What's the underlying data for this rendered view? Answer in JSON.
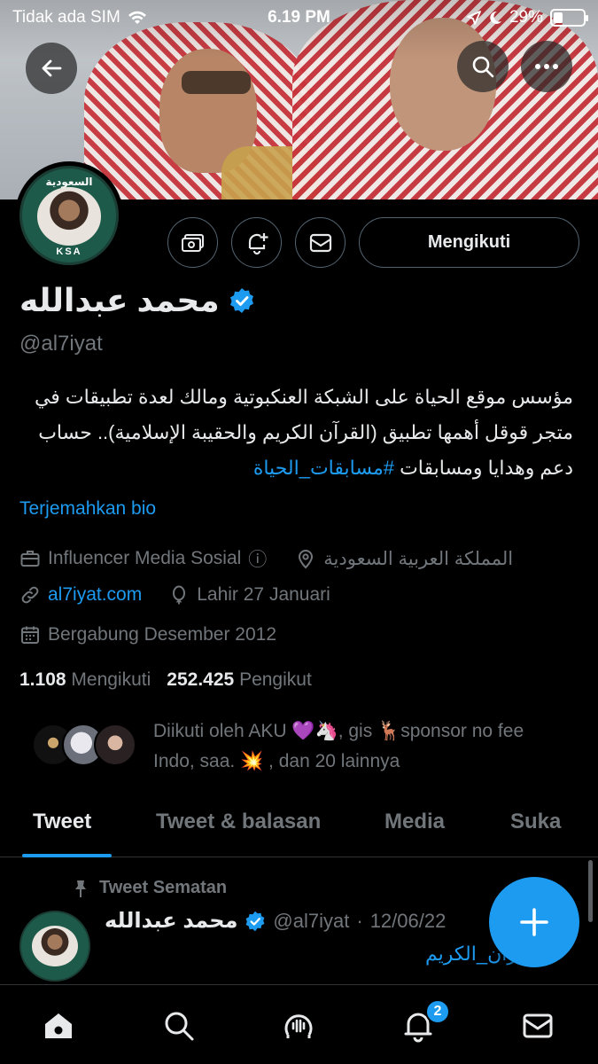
{
  "status_bar": {
    "carrier": "Tidak ada SIM",
    "time": "6.19 PM",
    "battery": "29%",
    "battery_level": 0.29
  },
  "profile": {
    "display_name": "محمد عبدالله",
    "handle": "@al7iyat",
    "banner_text": "السعودية",
    "banner_subtext": "KSA",
    "bio_main": "مؤسس موقع الحياة على الشبكة العنكبوتية ومالك لعدة تطبيقات في متجر قوقل أهمها تطبيق (القرآن الكريم والحقيبة الإسلامية).. حساب دعم وهدايا ومسابقات",
    "bio_hashtag": "#مسابقات_الحياة",
    "translate_label": "Terjemahkan bio",
    "category": "Influencer Media Sosial",
    "info_glyph": "ⓘ",
    "location": "المملكة العربية السعودية",
    "website": "al7iyat.com",
    "birthday": "Lahir 27 Januari",
    "joined": "Bergabung Desember 2012",
    "following_count": "1.108",
    "following_label": "Mengikuti",
    "followers_count": "252.425",
    "followers_label": "Pengikut",
    "followed_by": "Diikuti oleh AKU 💜🦄, gis 🦌sponsor no fee Indo, saa. 💥 , dan 20 lainnya"
  },
  "actions": {
    "follow_label": "Mengikuti"
  },
  "tabs": [
    {
      "label": "Tweet",
      "active": true
    },
    {
      "label": "Tweet & balasan",
      "active": false
    },
    {
      "label": "Media",
      "active": false
    },
    {
      "label": "Suka",
      "active": false
    }
  ],
  "pinned": {
    "label": "Tweet Sematan",
    "name": "محمد عبدالله",
    "handle": "@al7iyat",
    "sep": "·",
    "date": "12/06/22",
    "text": "#القرآن_الكريم"
  },
  "bottom_nav": {
    "notifications_badge": "2"
  },
  "colors": {
    "accent": "#1d9bf0",
    "background": "#000000",
    "muted": "#71767b",
    "text": "#e7e9ea"
  },
  "icons": [
    "back-icon",
    "search-icon",
    "more-icon",
    "tip-icon",
    "notify-icon",
    "message-icon",
    "verified-icon",
    "briefcase-icon",
    "location-icon",
    "link-icon",
    "balloon-icon",
    "calendar-icon",
    "pin-icon",
    "compose-icon",
    "home-icon",
    "spaces-icon",
    "bell-icon",
    "mail-icon"
  ]
}
